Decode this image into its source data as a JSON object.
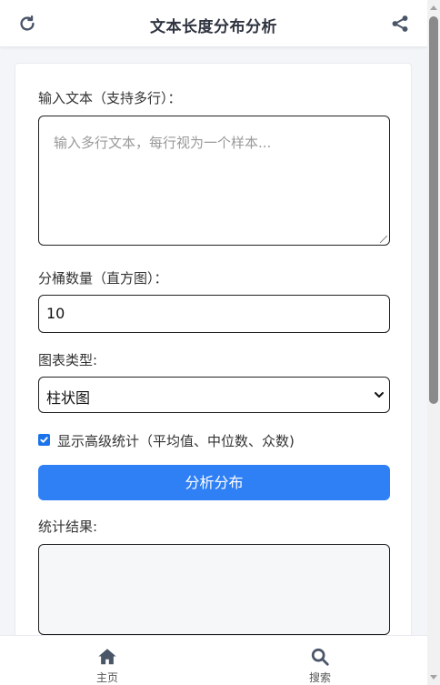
{
  "header": {
    "title": "文本长度分布分析",
    "left_icon": "refresh-icon",
    "right_icon": "share-icon"
  },
  "form": {
    "text_label": "输入文本（支持多行）：",
    "text_placeholder": "输入多行文本，每行视为一个样本...",
    "bins_label": "分桶数量（直方图）：",
    "bins_value": "10",
    "chart_type_label": "图表类型:",
    "chart_type_selected": "柱状图",
    "advanced_stats_label": "显示高级统计（平均值、中位数、众数)",
    "advanced_stats_checked": true,
    "analyze_button": "分析分布",
    "results_label": "统计结果:"
  },
  "bottom_nav": {
    "items": [
      {
        "label": "主页",
        "icon": "home-icon"
      },
      {
        "label": "搜索",
        "icon": "search-icon"
      }
    ]
  },
  "colors": {
    "accent": "#2f80f5",
    "checkbox": "#1a73e8",
    "icon": "#4a5568"
  }
}
